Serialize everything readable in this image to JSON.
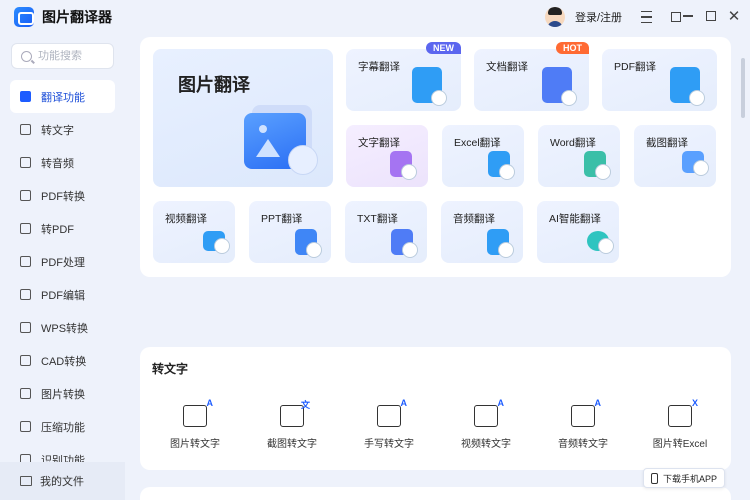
{
  "app": {
    "title": "图片翻译器"
  },
  "search": {
    "placeholder": "功能搜索"
  },
  "sidebar": {
    "items": [
      {
        "label": "翻译功能",
        "icon": "translate-icon",
        "active": true
      },
      {
        "label": "转文字",
        "icon": "text-icon"
      },
      {
        "label": "转音频",
        "icon": "audio-icon"
      },
      {
        "label": "PDF转换",
        "icon": "pdf-convert-icon"
      },
      {
        "label": "转PDF",
        "icon": "to-pdf-icon"
      },
      {
        "label": "PDF处理",
        "icon": "pdf-process-icon"
      },
      {
        "label": "PDF编辑",
        "icon": "pdf-edit-icon"
      },
      {
        "label": "WPS转换",
        "icon": "wps-icon"
      },
      {
        "label": "CAD转换",
        "icon": "cad-icon"
      },
      {
        "label": "图片转换",
        "icon": "image-convert-icon"
      },
      {
        "label": "压缩功能",
        "icon": "compress-icon"
      },
      {
        "label": "识别功能",
        "icon": "recognize-icon"
      }
    ],
    "my_files": "我的文件"
  },
  "header": {
    "login": "登录/注册"
  },
  "translate": {
    "hero": "图片翻译",
    "cards": [
      {
        "label": "字幕翻译",
        "badge": "NEW",
        "color": "#2f9df5"
      },
      {
        "label": "文档翻译",
        "badge": "HOT",
        "color": "#4f7cf6"
      },
      {
        "label": "PDF翻译",
        "color": "#2f9df5"
      },
      {
        "label": "文字翻译",
        "color": "#a574f2"
      },
      {
        "label": "Excel翻译",
        "color": "#2f9df5"
      },
      {
        "label": "Word翻译",
        "color": "#3bbfa8"
      },
      {
        "label": "截图翻译",
        "color": "#5aa0ff"
      },
      {
        "label": "视频翻译",
        "color": "#2f9df5"
      },
      {
        "label": "PPT翻译",
        "color": "#3f86f6"
      },
      {
        "label": "TXT翻译",
        "color": "#4f7cf6"
      },
      {
        "label": "音频翻译",
        "color": "#2f9df5"
      },
      {
        "label": "AI智能翻译",
        "color": "#2fc4c0"
      }
    ]
  },
  "to_text": {
    "title": "转文字",
    "tools": [
      {
        "label": "图片转文字",
        "icon": "image-text-icon",
        "glyph": "A"
      },
      {
        "label": "截图转文字",
        "icon": "screenshot-text-icon",
        "glyph": "文"
      },
      {
        "label": "手写转文字",
        "icon": "handwriting-text-icon",
        "glyph": "A"
      },
      {
        "label": "视频转文字",
        "icon": "video-text-icon",
        "glyph": "A"
      },
      {
        "label": "音频转文字",
        "icon": "audio-text-icon",
        "glyph": "A"
      },
      {
        "label": "图片转Excel",
        "icon": "image-excel-icon",
        "glyph": "X"
      }
    ]
  },
  "download": {
    "label": "下载手机APP"
  }
}
